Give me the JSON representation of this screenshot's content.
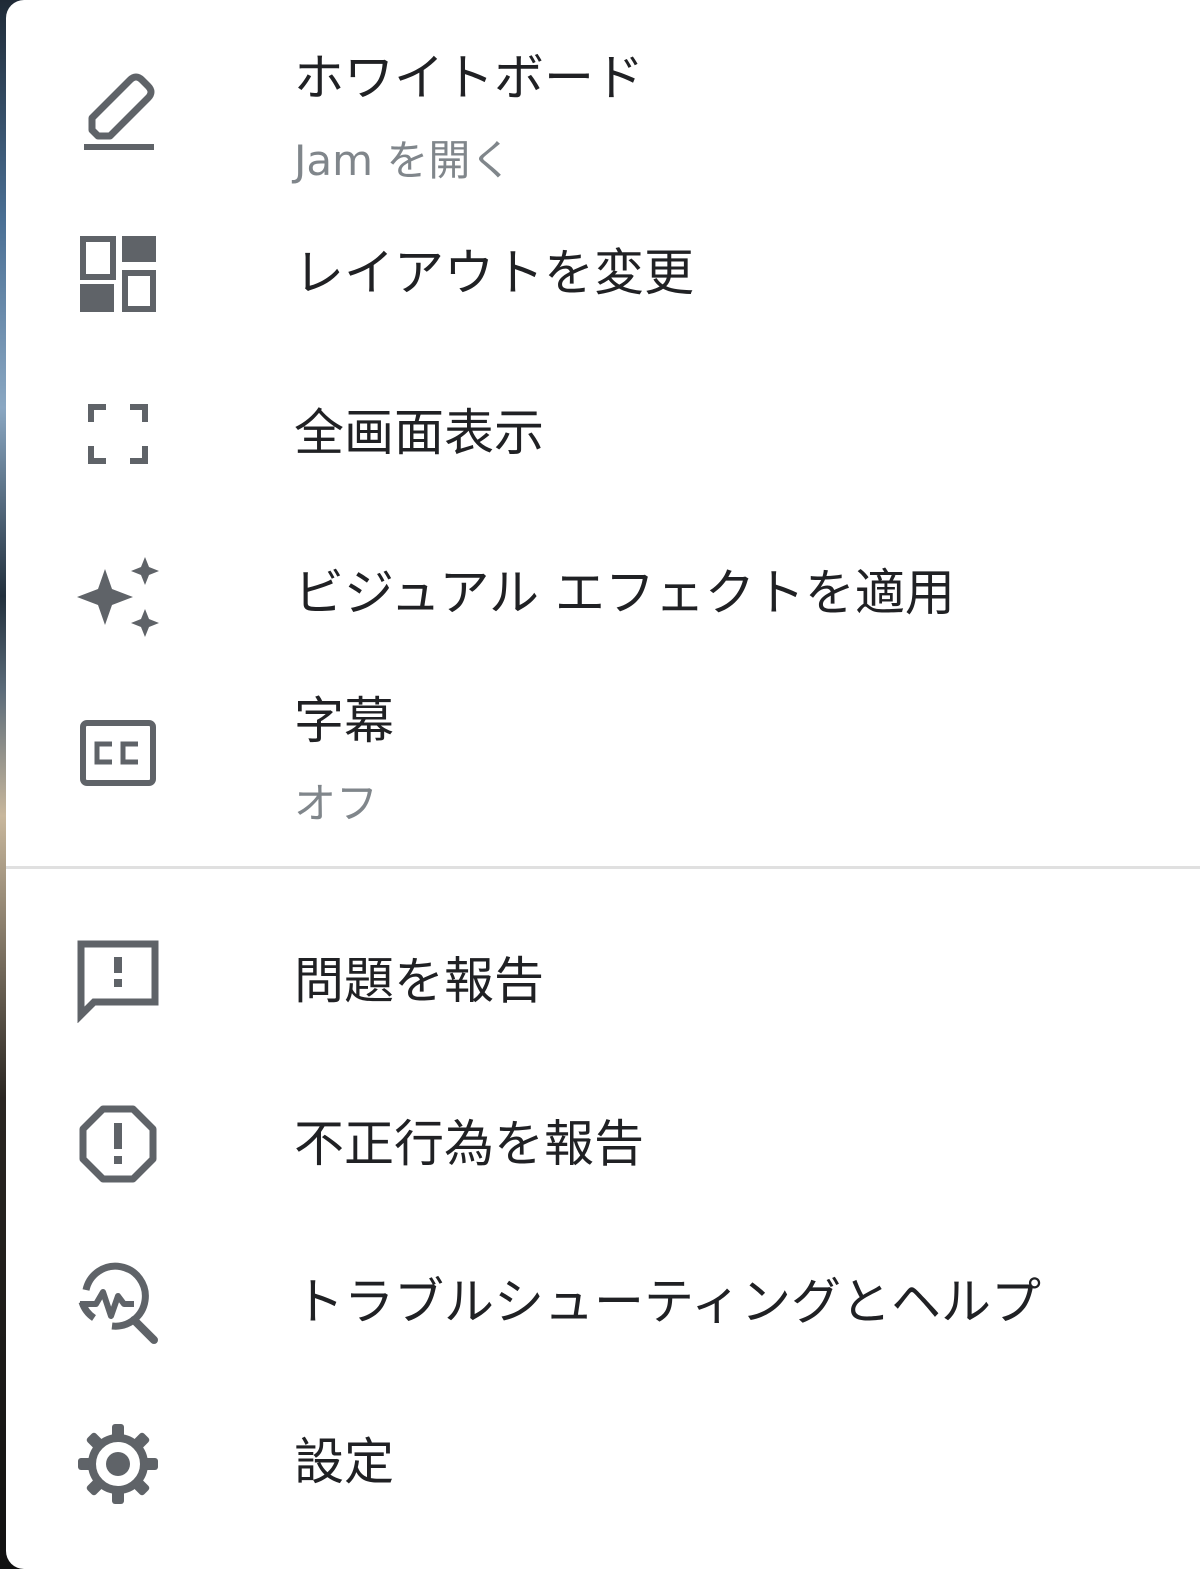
{
  "menu": {
    "items": [
      {
        "label": "ホワイトボード",
        "sublabel": "Jam を開く",
        "icon": "pencil-icon"
      },
      {
        "label": "レイアウトを変更",
        "icon": "dashboard-layout-icon"
      },
      {
        "label": "全画面表示",
        "icon": "fullscreen-icon"
      },
      {
        "label": "ビジュアル エフェクトを適用",
        "icon": "sparkle-icon"
      },
      {
        "label": "字幕",
        "sublabel": "オフ",
        "icon": "closed-caption-icon"
      },
      {
        "label": "問題を報告",
        "icon": "feedback-icon"
      },
      {
        "label": "不正行為を報告",
        "icon": "report-abuse-icon"
      },
      {
        "label": "トラブルシューティングとヘルプ",
        "icon": "troubleshoot-icon"
      },
      {
        "label": "設定",
        "icon": "gear-icon"
      }
    ]
  },
  "colors": {
    "icon": "#5f6368",
    "text": "#202124",
    "secondary_text": "#80868b",
    "divider": "#e0e0e0"
  }
}
